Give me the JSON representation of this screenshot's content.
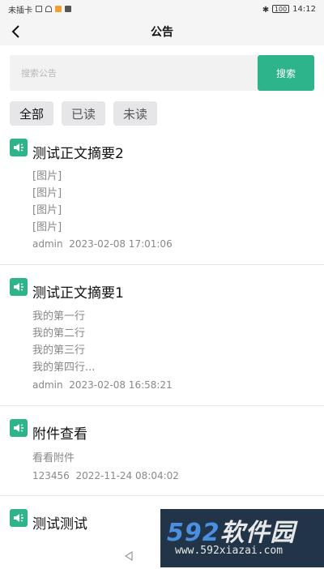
{
  "status_bar": {
    "carrier": "未插卡",
    "battery": "100",
    "time": "14:12"
  },
  "header": {
    "title": "公告"
  },
  "search": {
    "placeholder": "搜索公告",
    "button_label": "搜索"
  },
  "filters": [
    {
      "label": "全部",
      "active": true
    },
    {
      "label": "已读",
      "active": false
    },
    {
      "label": "未读",
      "active": false
    }
  ],
  "notices": [
    {
      "title": "测试正文摘要2",
      "lines": [
        "[图片]",
        "[图片]",
        "[图片]",
        "[图片]"
      ],
      "author": "admin",
      "datetime": "2023-02-08 17:01:06"
    },
    {
      "title": "测试正文摘要1",
      "lines": [
        "我的第一行",
        "我的第二行",
        "我的第三行",
        "我的第四行..."
      ],
      "author": "admin",
      "datetime": "2023-02-08 16:58:21"
    },
    {
      "title": "附件查看",
      "lines": [
        "看看附件"
      ],
      "author": "123456",
      "datetime": "2022-11-24 08:04:02"
    },
    {
      "title": "测试测试",
      "lines": [],
      "author": "",
      "datetime": ""
    }
  ],
  "watermark": {
    "number": "592",
    "text": "软件园",
    "url": "www.592xiazai.com"
  },
  "colors": {
    "accent": "#2db48b"
  },
  "icons": {
    "back": "chevron-left-icon",
    "notice": "speaker-icon"
  }
}
